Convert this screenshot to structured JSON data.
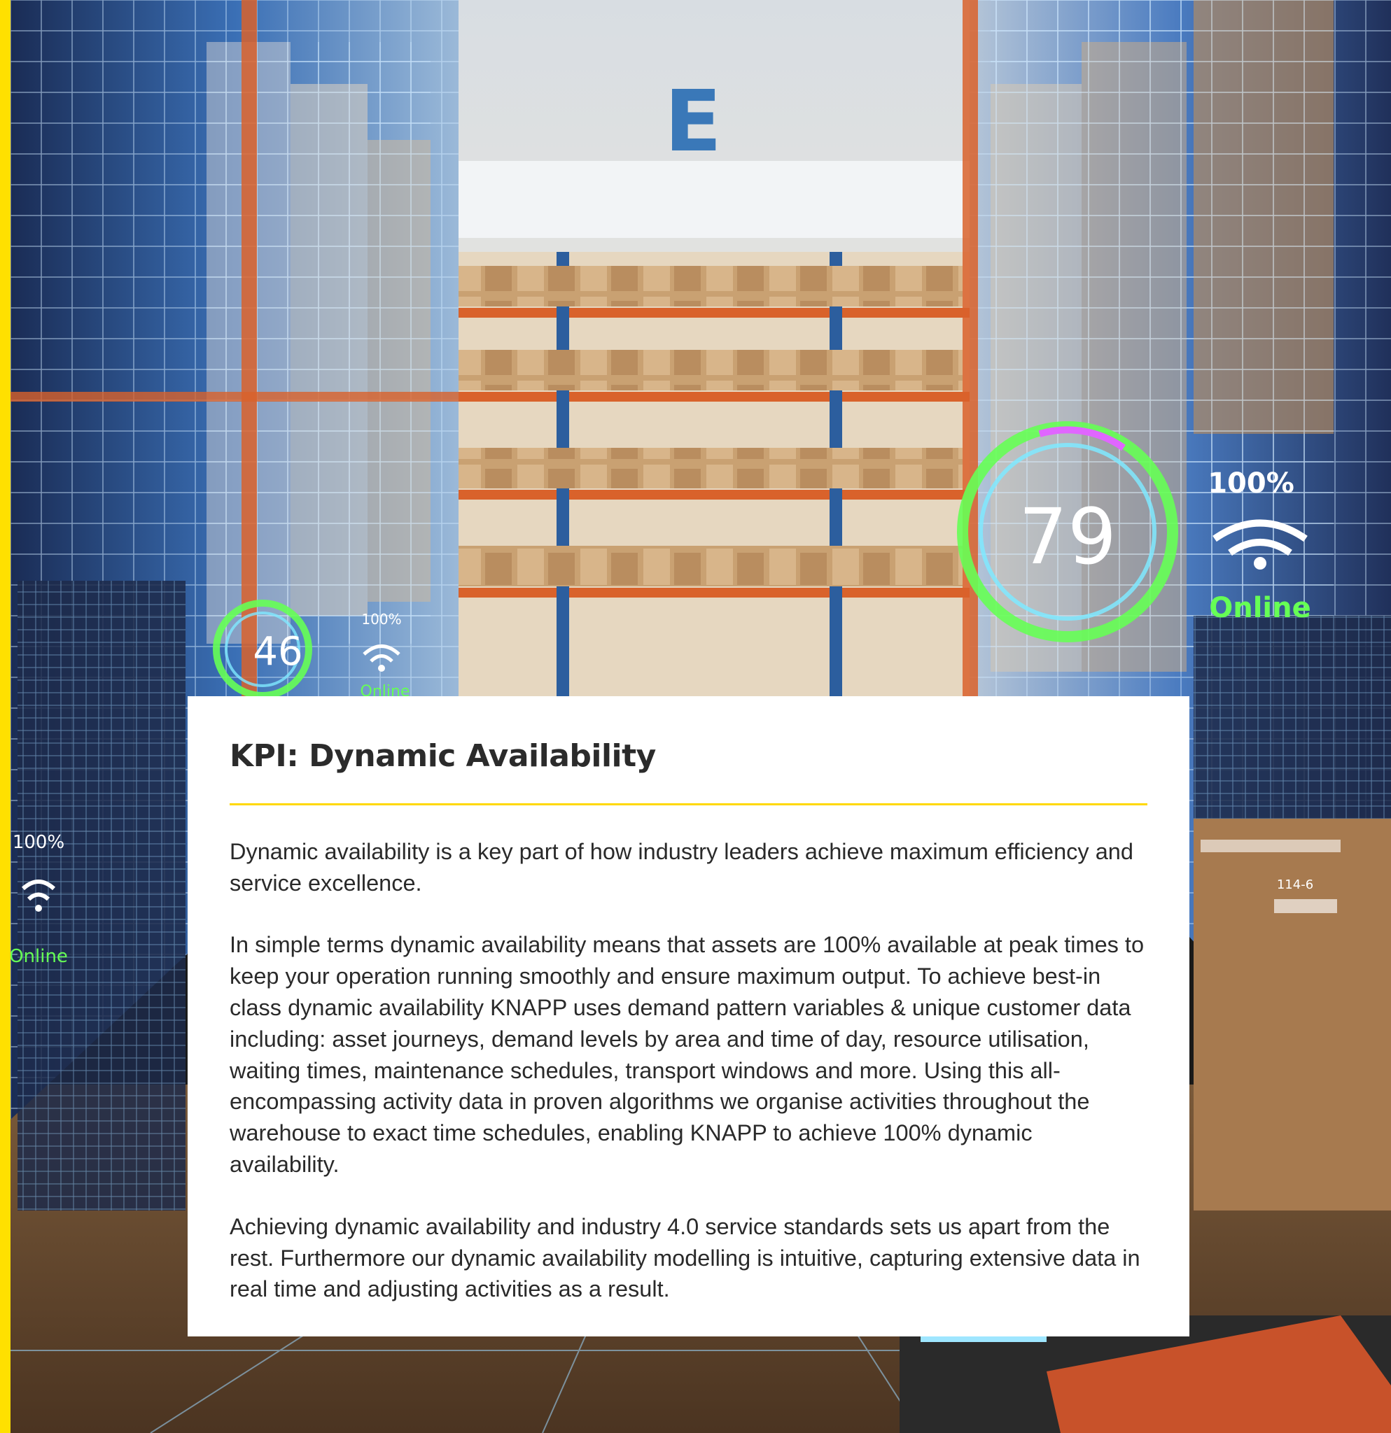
{
  "card": {
    "title": "KPI: Dynamic Availability",
    "paragraphs": [
      "Dynamic availability is a key part of how industry leaders achieve maximum efficiency and service excellence.",
      "In simple terms dynamic availability means that assets are 100% available at peak times to keep your operation running smoothly and ensure maximum output. To achieve best-in class dynamic availability KNAPP uses demand pattern variables & unique customer data including: asset journeys, demand levels by area and time of day, resource utilisation, waiting times, maintenance schedules, transport windows and more. Using this all-encompassing activity data in proven algorithms we organise activities throughout the warehouse to exact time schedules, enabling KNAPP to achieve 100% dynamic availability.",
      "Achieving dynamic availability and industry 4.0 service standards sets us apart from the rest. Furthermore our dynamic availability modelling is intuitive, capturing extensive data in real time and adjusting activities as a result."
    ]
  },
  "photo_overlay": {
    "aisle_sign": "E",
    "gauge_left_value": "46",
    "gauge_left_signal": "100%",
    "gauge_left_status": "Online",
    "gauge_right_value": "79",
    "gauge_right_signal": "100%",
    "gauge_right_status": "Online",
    "far_left_signal": "100%",
    "far_left_status": "Online",
    "box_label": "114-6"
  },
  "colors": {
    "accent_yellow": "#ffe000",
    "rule_yellow": "#ffd800",
    "rack_orange": "#d9622b",
    "rack_blue": "#2c5e9e",
    "hologram_cyan": "#7fe9ff",
    "gauge_green": "#66ff55",
    "text_dark": "#2a2a2a"
  }
}
